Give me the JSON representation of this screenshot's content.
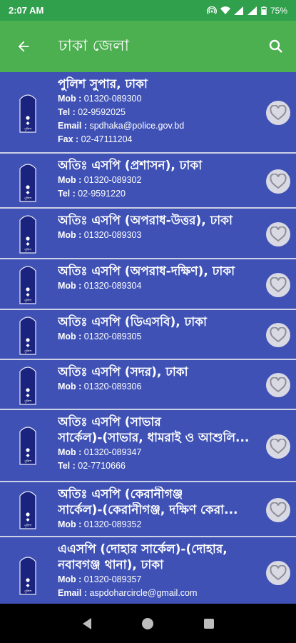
{
  "status": {
    "time": "2:07 AM",
    "battery": "75%"
  },
  "app_bar": {
    "title": "ঢাকা জেলা"
  },
  "rows": [
    {
      "title": "পুলিশ সুপার, ঢাকা",
      "lines": [
        {
          "label": "Mob :",
          "value": " 01320-089300"
        },
        {
          "label": "Tel :",
          "value": " 02-9592025"
        },
        {
          "label": "Email :",
          "value": " spdhaka@police.gov.bd"
        },
        {
          "label": "Fax :",
          "value": " 02-47111204"
        }
      ]
    },
    {
      "title": "অতিঃ এসপি (প্রশাসন), ঢাকা",
      "lines": [
        {
          "label": "Mob :",
          "value": " 01320-089302"
        },
        {
          "label": "Tel :",
          "value": " 02-9591220"
        }
      ]
    },
    {
      "title": "অতিঃ এসপি (অপরাধ-উত্তর), ঢাকা",
      "lines": [
        {
          "label": "Mob :",
          "value": " 01320-089303"
        }
      ]
    },
    {
      "title": "অতিঃ এসপি (অপরাধ-দক্ষিণ), ঢাকা",
      "lines": [
        {
          "label": "Mob :",
          "value": " 01320-089304"
        }
      ]
    },
    {
      "title": "অতিঃ এসপি (ডিএসবি), ঢাকা",
      "lines": [
        {
          "label": "Mob :",
          "value": " 01320-089305"
        }
      ]
    },
    {
      "title": "অতিঃ এসপি (সদর), ঢাকা",
      "lines": [
        {
          "label": "Mob :",
          "value": " 01320-089306"
        }
      ]
    },
    {
      "title": "অতিঃ এসপি (সাভার",
      "title2": "সার্কেল)-(সাভার, ধামরাই ও আশুলি...",
      "lines": [
        {
          "label": "Mob :",
          "value": " 01320-089347"
        },
        {
          "label": "Tel :",
          "value": " 02-7710666"
        }
      ]
    },
    {
      "title": "অতিঃ এসপি (কেরানীগঞ্জ",
      "title2": "সার্কেল)-(কেরানীগঞ্জ, দক্ষিণ কেরা...",
      "lines": [
        {
          "label": "Mob :",
          "value": " 01320-089352"
        }
      ]
    },
    {
      "title": "এএসপি (দোহার সার্কেল)-(দোহার,",
      "title2": "নবাবগঞ্জ থানা), ঢাকা",
      "lines": [
        {
          "label": "Mob :",
          "value": " 01320-089357"
        },
        {
          "label": "Email :",
          "value": " aspdoharcircle@gmail.com"
        }
      ]
    }
  ],
  "badge_text": "পুলিশ",
  "colors": {
    "status_bar": "#30a04d",
    "app_bar": "#4caf50",
    "list_bg": "#3f51b5",
    "divider": "#cdd1e6"
  },
  "icons": {
    "back": "arrow-left-icon",
    "search": "search-icon",
    "favorite": "heart-outline-icon"
  }
}
